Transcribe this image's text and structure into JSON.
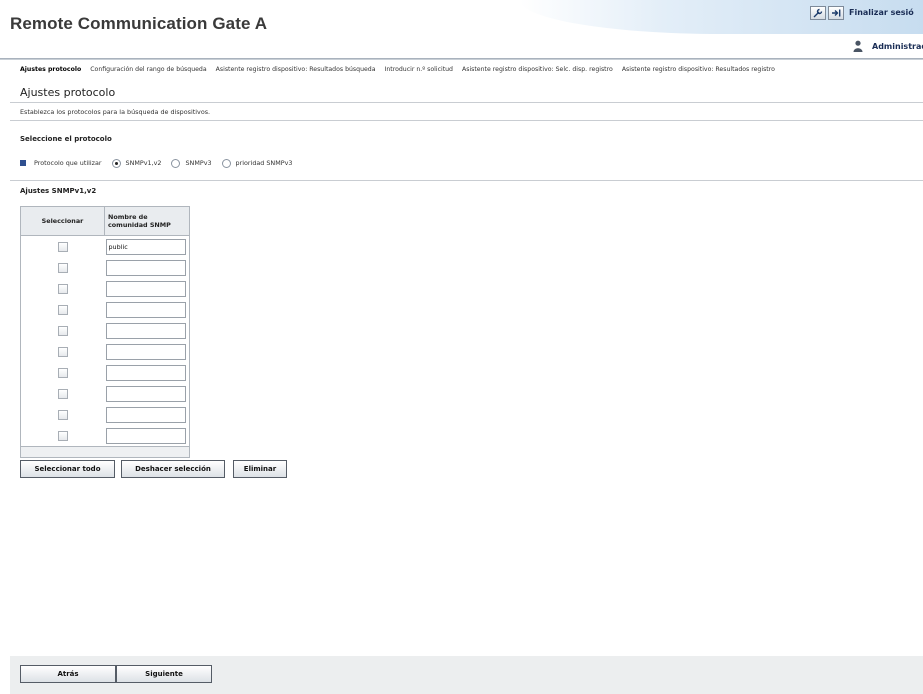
{
  "app": {
    "title": "Remote Communication Gate A",
    "logout_label": "Finalizar sesió",
    "user_label": "Administrado"
  },
  "tabs": [
    {
      "label": "Ajustes protocolo"
    },
    {
      "label": "Configuración del rango de búsqueda"
    },
    {
      "label": "Asistente registro dispositivo: Resultados búsqueda"
    },
    {
      "label": "Introducir n.º solicitud"
    },
    {
      "label": "Asistente registro dispositivo: Selc. disp. registro"
    },
    {
      "label": "Asistente registro dispositivo: Resultados registro"
    }
  ],
  "page": {
    "title": "Ajustes protocolo",
    "description": "Establezca los protocolos para la búsqueda de dispositivos."
  },
  "protocol": {
    "section_title": "Seleccione el protocolo",
    "label": "Protocolo que utilizar",
    "options": [
      "SNMPv1,v2",
      "SNMPv3",
      "prioridad SNMPv3"
    ],
    "selected": "SNMPv1,v2"
  },
  "snmp": {
    "section_title": "Ajustes SNMPv1,v2",
    "col_select": "Seleccionar",
    "col_name_line1": "Nombre de",
    "col_name_line2": "comunidad SNMP",
    "rows": [
      "public",
      "",
      "",
      "",
      "",
      "",
      "",
      "",
      "",
      ""
    ]
  },
  "buttons": {
    "select_all": "Seleccionar todo",
    "deselect": "Deshacer selección",
    "delete": "Eliminar",
    "back": "Atrás",
    "next": "Siguiente"
  },
  "icons": {
    "settings": "wrench-icon",
    "logout": "logout-arrow-icon",
    "user": "user-icon"
  }
}
